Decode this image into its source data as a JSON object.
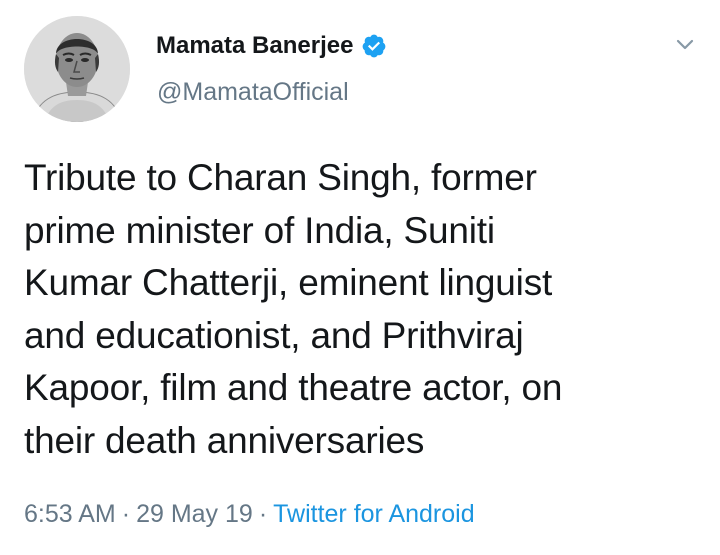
{
  "author": {
    "display_name": "Mamata Banerjee",
    "handle": "@MamataOfficial",
    "verified": true,
    "verified_icon": "verified-badge-icon",
    "avatar_icon": "portrait-avatar"
  },
  "tweet": {
    "lines": [
      "Tribute to Charan Singh, former",
      "prime minister of India, Suniti",
      "Kumar Chatterji, eminent linguist",
      "and educationist, and Prithviraj",
      "Kapoor, film and theatre actor, on",
      "their death anniversaries"
    ]
  },
  "meta": {
    "time": "6:53 AM",
    "date": "29 May 19",
    "separator": "·",
    "source": "Twitter for Android"
  },
  "colors": {
    "text": "#14171a",
    "secondary": "#657786",
    "link": "#1b95e0",
    "verified": "#1da1f2"
  }
}
